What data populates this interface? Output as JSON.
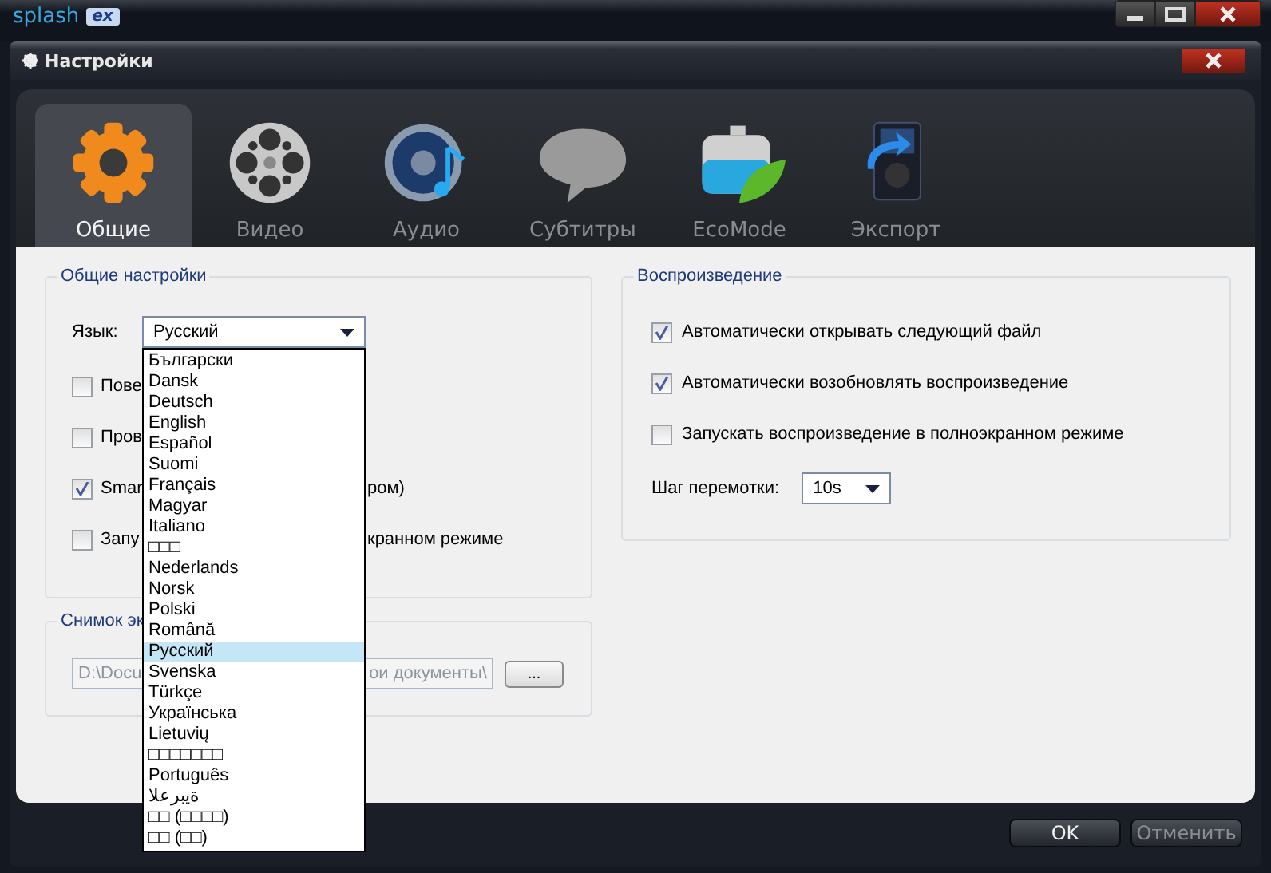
{
  "app": {
    "logo": "splash",
    "logo_badge": "ex"
  },
  "dialog": {
    "title": "Настройки"
  },
  "tabs": [
    {
      "label": "Общие",
      "kind": "gear",
      "selected": true
    },
    {
      "label": "Видео",
      "kind": "reel",
      "selected": false
    },
    {
      "label": "Аудио",
      "kind": "speaker",
      "selected": false
    },
    {
      "label": "Субтитры",
      "kind": "bubble",
      "selected": false
    },
    {
      "label": "EcoMode",
      "kind": "battery",
      "selected": false
    },
    {
      "label": "Экспорт",
      "kind": "player",
      "selected": false
    }
  ],
  "general": {
    "title": "Общие настройки",
    "language_label": "Язык:",
    "language_value": "Русский",
    "language_options": [
      {
        "label": "Български",
        "selected": false
      },
      {
        "label": "Dansk",
        "selected": false
      },
      {
        "label": "Deutsch",
        "selected": false
      },
      {
        "label": "English",
        "selected": false
      },
      {
        "label": "Español",
        "selected": false
      },
      {
        "label": "Suomi",
        "selected": false
      },
      {
        "label": "Français",
        "selected": false
      },
      {
        "label": "Magyar",
        "selected": false
      },
      {
        "label": "Italiano",
        "selected": false
      },
      {
        "label": "□□□",
        "selected": false
      },
      {
        "label": "Nederlands",
        "selected": false
      },
      {
        "label": "Norsk",
        "selected": false
      },
      {
        "label": "Polski",
        "selected": false
      },
      {
        "label": "Română",
        "selected": false
      },
      {
        "label": "Русский",
        "selected": true
      },
      {
        "label": "Svenska",
        "selected": false
      },
      {
        "label": "Türkçe",
        "selected": false
      },
      {
        "label": "Українська",
        "selected": false
      },
      {
        "label": "Lietuvių",
        "selected": false
      },
      {
        "label": "□□□□□□□",
        "selected": false
      },
      {
        "label": "Português",
        "selected": false
      },
      {
        "label": "ةيبرعلا",
        "selected": false
      },
      {
        "label": "□□ (□□□□)",
        "selected": false
      },
      {
        "label": "□□ (□□)",
        "selected": false
      }
    ],
    "options": [
      {
        "text_start": "Пове",
        "checked": false
      },
      {
        "text_start": "Пров",
        "checked": false
      },
      {
        "text_start": "Smar",
        "text_end": "ром)",
        "checked": true
      },
      {
        "text_start": "Запу",
        "text_end": "кранном режиме",
        "checked": false
      }
    ]
  },
  "screenshot": {
    "title": "Снимок эк",
    "path_start": "D:\\Docu",
    "path_end": "ои документы\\",
    "browse_button": "..."
  },
  "playback": {
    "title": "Воспроизведение",
    "options": [
      {
        "label": "Автоматически открывать следующий файл",
        "checked": true
      },
      {
        "label": "Автоматически возобновлять воспроизведение",
        "checked": true
      },
      {
        "label": "Запускать воспроизведение в полноэкранном режиме",
        "checked": false
      }
    ],
    "seek_label": "Шаг перемотки:",
    "seek_value": "10s"
  },
  "buttons": [
    {
      "label": "OK",
      "disabled": false
    },
    {
      "label": "Отменить",
      "disabled": true
    }
  ]
}
